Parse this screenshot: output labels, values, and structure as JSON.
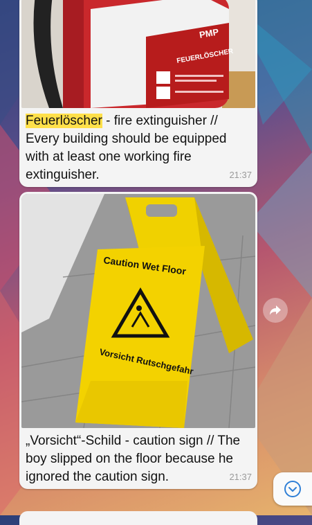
{
  "messages": [
    {
      "caption_highlight": "Feuerlöscher",
      "caption_rest": " - fire extinguisher // Every building should be equipped with at least one working fire extinguisher.",
      "time": "21:37",
      "image_text_brand": "PMP",
      "image_text_label": "FEUERLÖSCHER"
    },
    {
      "caption": "„Vorsicht“-Schild - caution sign // The boy slipped on the floor because he ignored the caution sign.",
      "time": "21:37",
      "image_text_top": "Caution Wet Floor",
      "image_text_bottom": "Vorsicht Rutschgefahr"
    }
  ],
  "icons": {
    "forward": "forward-arrow-icon",
    "scroll_down": "chevron-down-circle-icon"
  },
  "colors": {
    "bubble_bg": "#f4f4f4",
    "highlight": "#ffe04a",
    "accent": "#2f7fd6"
  }
}
